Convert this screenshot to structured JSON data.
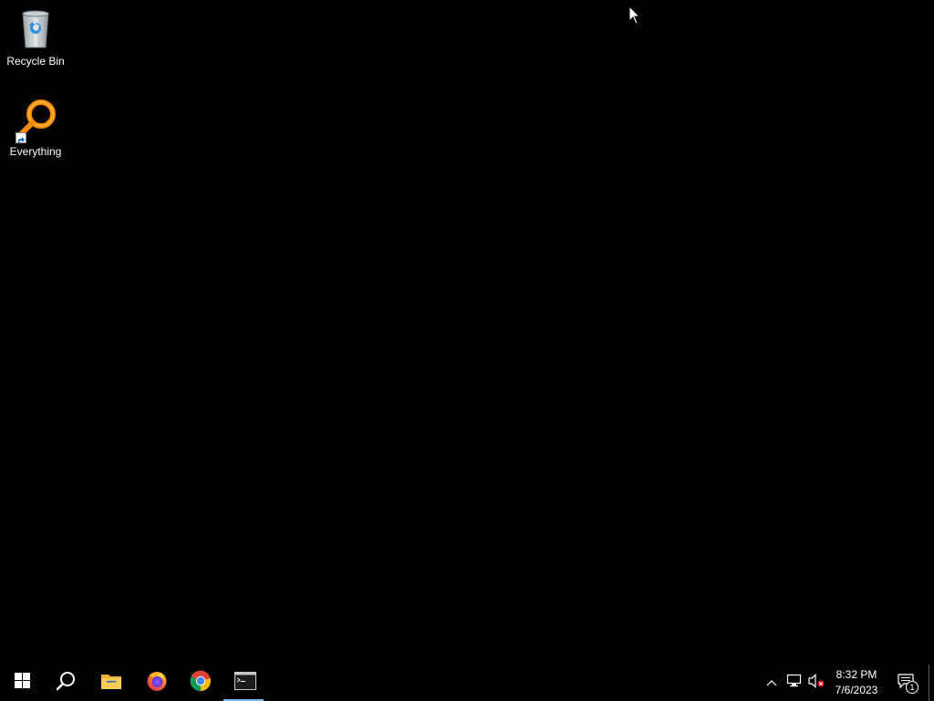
{
  "desktop": {
    "icons": [
      {
        "label": "Recycle Bin",
        "icon": "recycle-bin-icon"
      },
      {
        "label": "Everything",
        "icon": "everything-search-icon"
      }
    ]
  },
  "taskbar": {
    "buttons": [
      {
        "name": "start",
        "icon": "windows-logo-icon"
      },
      {
        "name": "search",
        "icon": "search-icon"
      },
      {
        "name": "file-explorer",
        "icon": "folder-icon"
      },
      {
        "name": "firefox",
        "icon": "firefox-icon"
      },
      {
        "name": "chrome",
        "icon": "chrome-icon"
      },
      {
        "name": "command-prompt",
        "icon": "terminal-icon",
        "active": true
      }
    ],
    "tray": {
      "time": "8:32 PM",
      "date": "7/6/2023",
      "notification_count": "1",
      "volume_muted": true
    },
    "colors": {
      "active_indicator": "#76b9ed",
      "background": "#000000"
    }
  }
}
